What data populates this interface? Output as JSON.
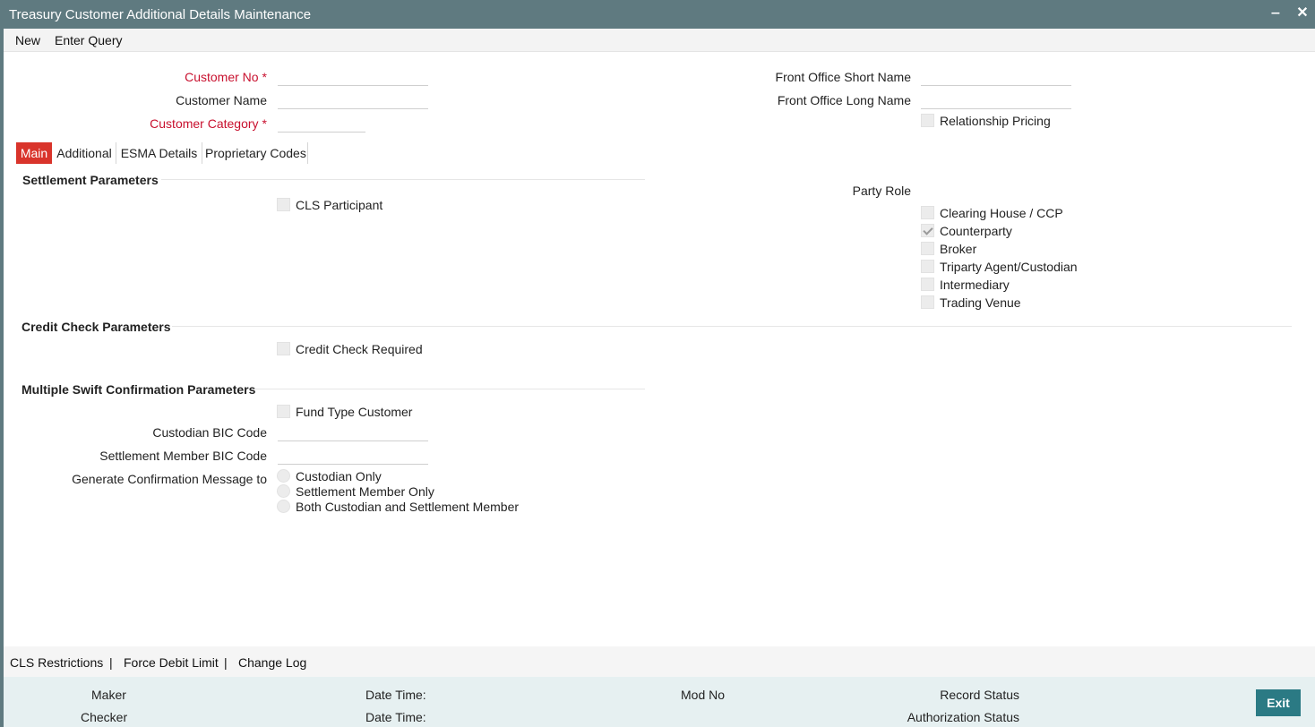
{
  "window": {
    "title": "Treasury Customer Additional Details Maintenance",
    "minimize_glyph": "‒",
    "close_glyph": "✕"
  },
  "menu": {
    "new_label": "New",
    "enter_query_label": "Enter Query"
  },
  "header": {
    "customer_no_label": "Customer No",
    "customer_name_label": "Customer Name",
    "customer_category_label": "Customer Category",
    "required_marker": "*",
    "fo_short_name_label": "Front Office Short Name",
    "fo_long_name_label": "Front Office Long Name",
    "relationship_pricing_label": "Relationship Pricing",
    "customer_no_value": "",
    "customer_name_value": "",
    "customer_category_value": "",
    "fo_short_name_value": "",
    "fo_long_name_value": ""
  },
  "tabs": [
    {
      "label": "Main",
      "active": true
    },
    {
      "label": "Additional",
      "active": false
    },
    {
      "label": "ESMA Details",
      "active": false
    },
    {
      "label": "Proprietary Codes",
      "active": false
    }
  ],
  "settlement": {
    "heading": "Settlement Parameters",
    "cls_participant_label": "CLS Participant",
    "party_role_label": "Party Role",
    "roles": [
      {
        "label": "Clearing House / CCP",
        "checked": false
      },
      {
        "label": "Counterparty",
        "checked": true
      },
      {
        "label": "Broker",
        "checked": false
      },
      {
        "label": "Triparty Agent/Custodian",
        "checked": false
      },
      {
        "label": "Intermediary",
        "checked": false
      },
      {
        "label": "Trading Venue",
        "checked": false
      }
    ]
  },
  "credit_check": {
    "heading": "Credit Check Parameters",
    "required_label": "Credit Check Required"
  },
  "swift": {
    "heading": "Multiple Swift Confirmation Parameters",
    "fund_type_label": "Fund Type Customer",
    "custodian_bic_label": "Custodian BIC Code",
    "settlement_member_bic_label": "Settlement Member BIC Code",
    "generate_label": "Generate Confirmation Message to",
    "options": [
      "Custodian Only",
      "Settlement Member Only",
      "Both Custodian and Settlement Member"
    ],
    "custodian_bic_value": "",
    "settlement_member_bic_value": ""
  },
  "footer_links": {
    "cls_restrictions": "CLS Restrictions",
    "force_debit_limit": "Force Debit Limit",
    "change_log": "Change Log",
    "separator": "|"
  },
  "status": {
    "maker_label": "Maker",
    "checker_label": "Checker",
    "date_time_label": "Date Time:",
    "mod_no_label": "Mod No",
    "record_status_label": "Record Status",
    "authorization_status_label": "Authorization Status",
    "exit_label": "Exit"
  },
  "colors": {
    "titlebar": "#5f7a80",
    "required": "#c8102e",
    "active_tab": "#d9342b",
    "exit_button": "#2b7a84",
    "statusbar": "#e6f0f1"
  }
}
